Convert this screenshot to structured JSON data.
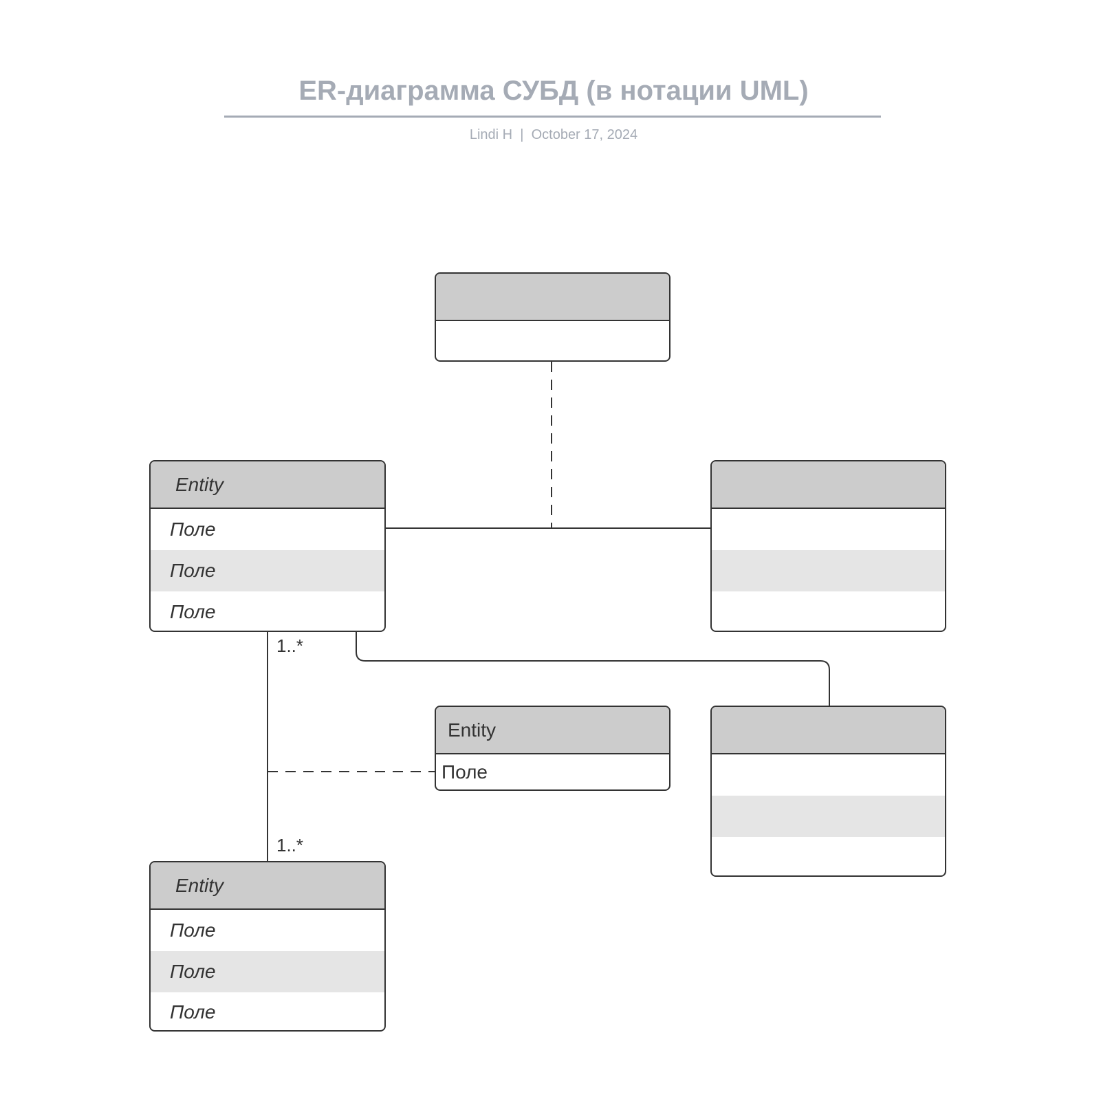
{
  "document": {
    "title": "ER-диаграмма СУБД (в нотации UML)",
    "author": "Lindi H",
    "separator": "|",
    "date": "October 17, 2024"
  },
  "entities": {
    "top": {
      "header": "",
      "rows": [
        ""
      ]
    },
    "left": {
      "header": "Entity",
      "rows": [
        "Поле",
        "Поле",
        "Поле"
      ]
    },
    "right": {
      "header": "",
      "rows": [
        "",
        "",
        ""
      ]
    },
    "middle": {
      "header": "Entity",
      "rows": [
        "Поле"
      ]
    },
    "bottom_right": {
      "header": "",
      "rows": [
        "",
        "",
        ""
      ]
    },
    "bottom_left": {
      "header": "Entity",
      "rows": [
        "Поле",
        "Поле",
        "Поле"
      ]
    }
  },
  "relationships": [
    {
      "from": "left",
      "to": "right",
      "style": "solid"
    },
    {
      "from": "top",
      "to": "left-right association",
      "style": "dashed"
    },
    {
      "from": "left",
      "to": "bottom_right",
      "style": "solid"
    },
    {
      "from": "left",
      "to": "bottom_left",
      "style": "solid",
      "multiplicity_source": "1..*",
      "multiplicity_target": "1..*"
    },
    {
      "from": "middle",
      "to": "left-bottom_left association",
      "style": "dashed"
    }
  ],
  "colors": {
    "title": "#A5ABB5",
    "header_fill": "#CCCCCC",
    "alt_row_fill": "#E5E5E5",
    "stroke": "#333333"
  }
}
